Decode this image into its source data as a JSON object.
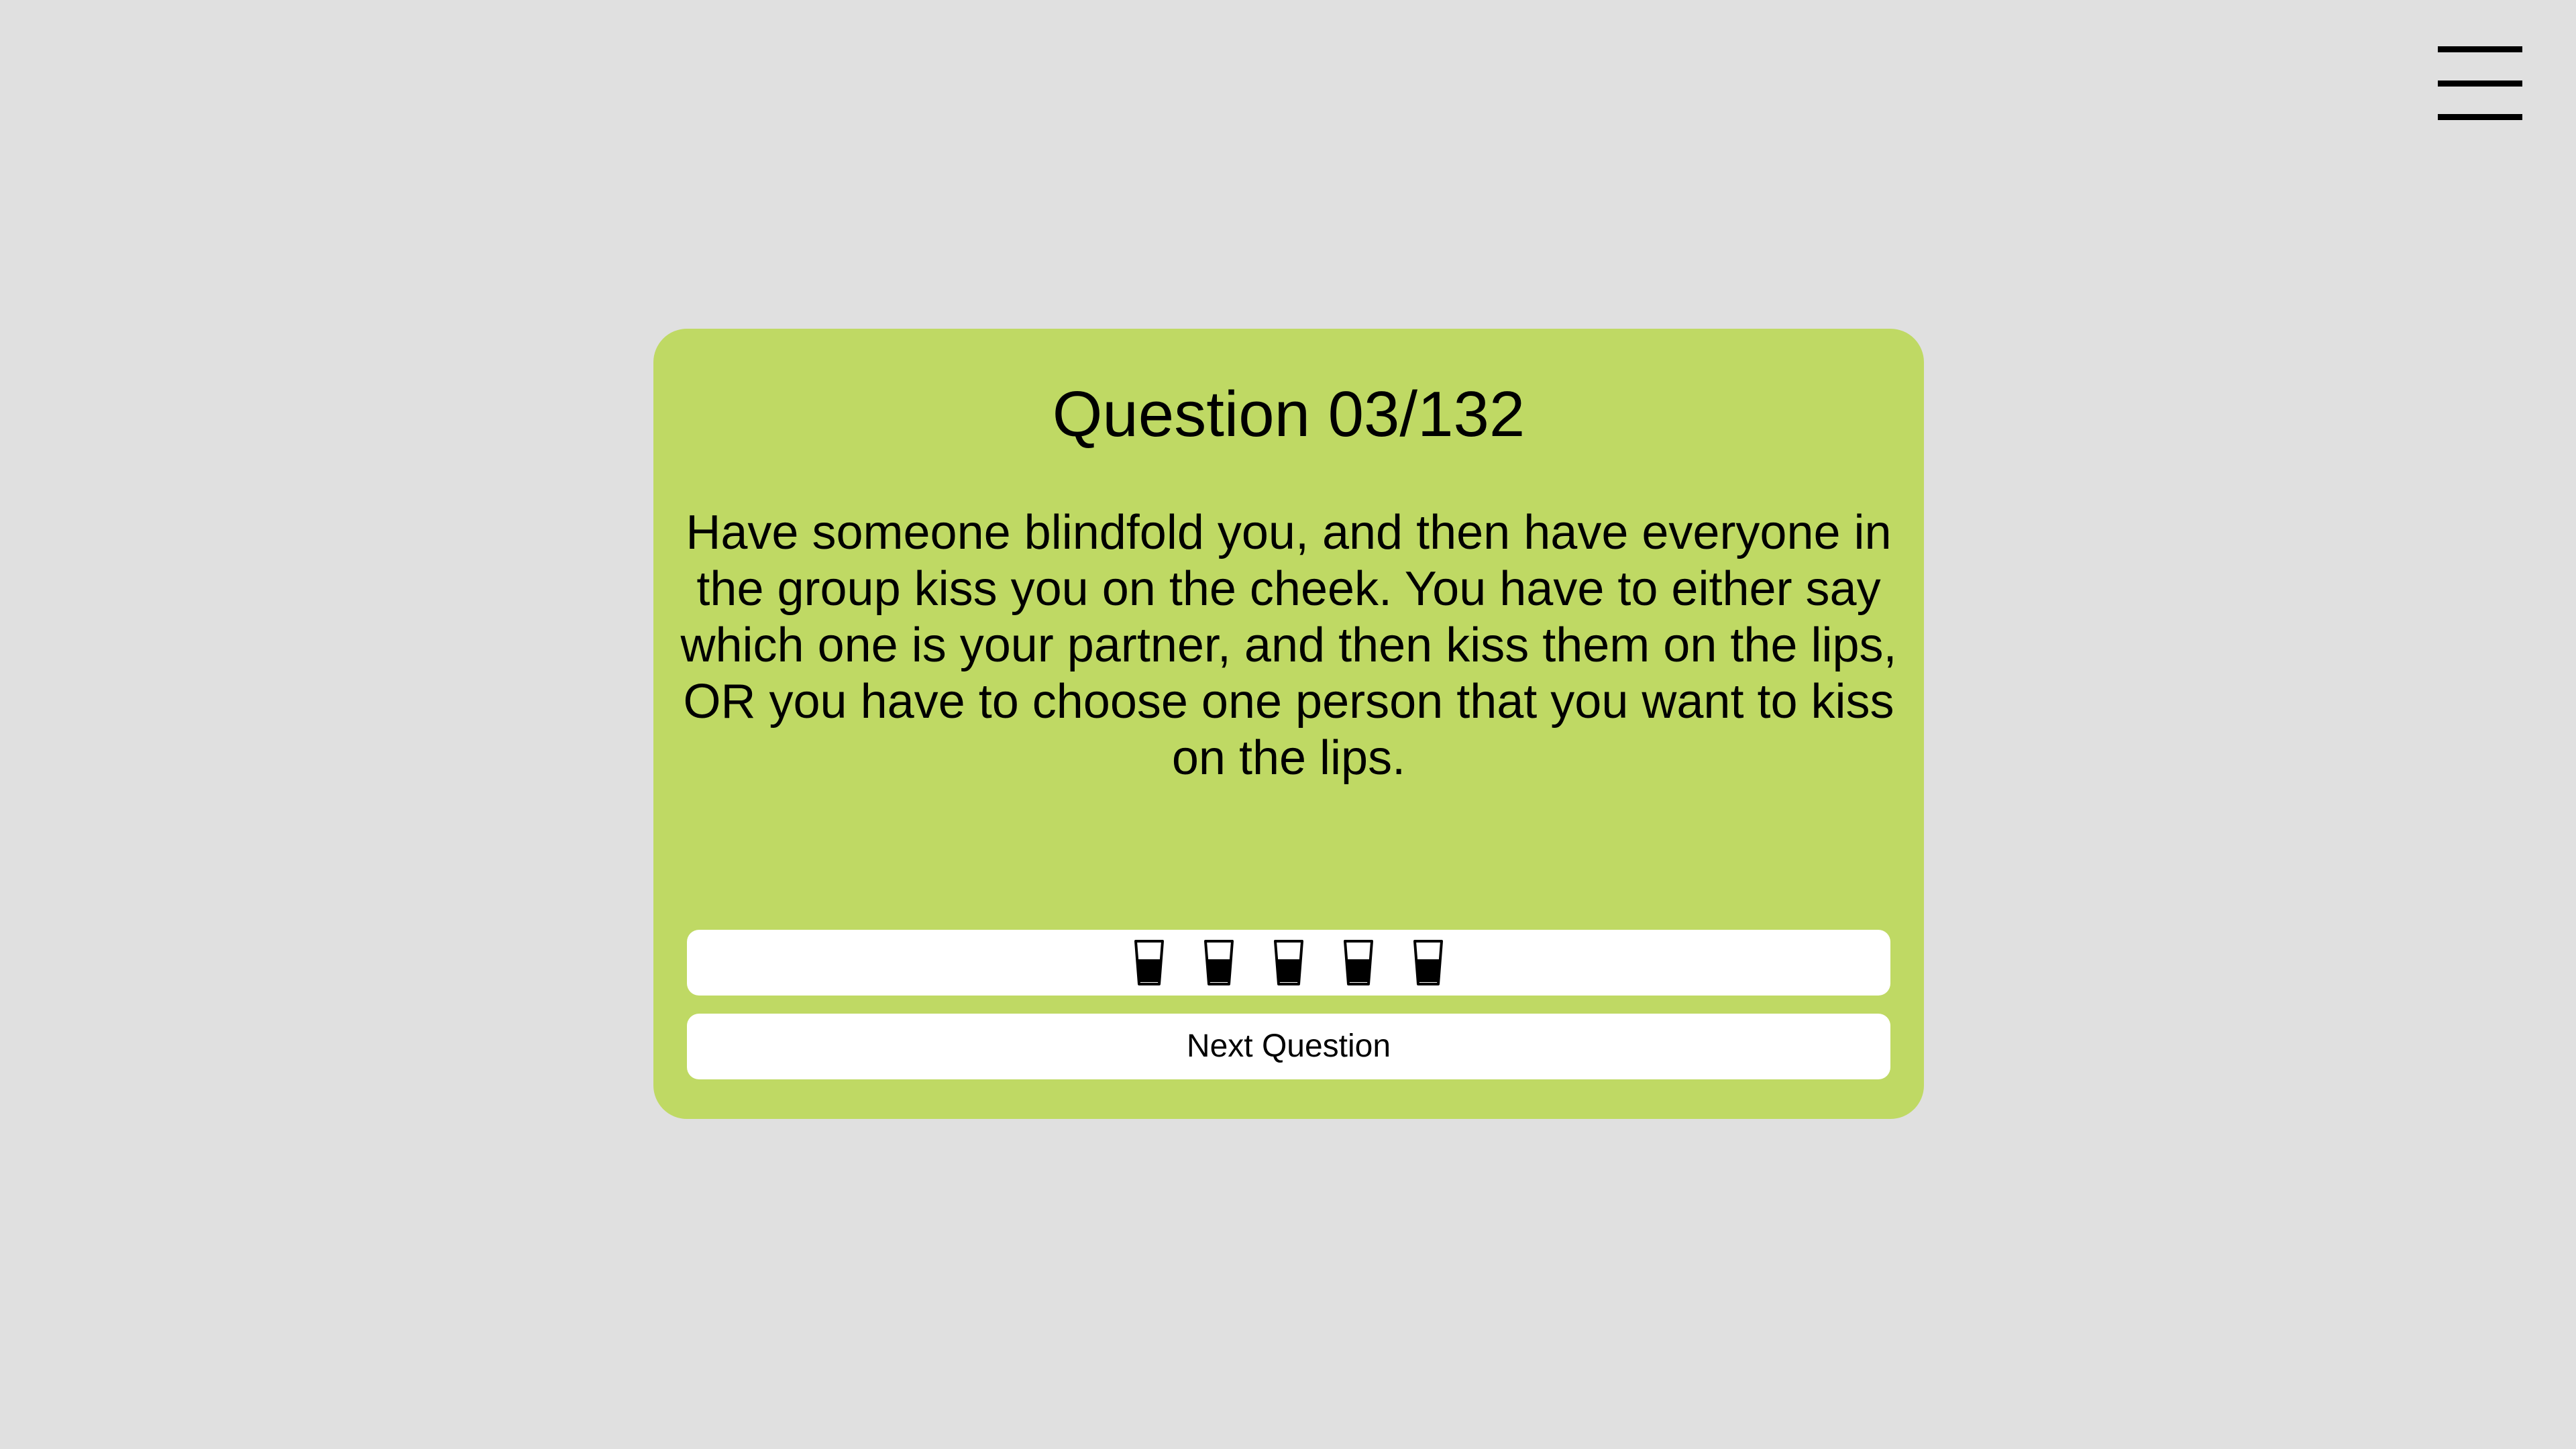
{
  "header": {
    "menu_icon": "hamburger-menu-icon"
  },
  "card": {
    "title": "Question 03/132",
    "question": "Have someone blindfold you, and then have everyone in the group kiss you on the cheek. You have to either say which one is your partner, and then kiss them on the lips, OR you have to choose one person that you want to kiss on the lips.",
    "background_color": "#bfd964"
  },
  "rating": {
    "icon": "shot-glass-icon",
    "count": 5
  },
  "actions": {
    "next_label": "Next Question"
  },
  "colors": {
    "page_background": "#e0e0e0",
    "accent": "#bfd964",
    "button_background": "#ffffff",
    "text": "#000000"
  }
}
